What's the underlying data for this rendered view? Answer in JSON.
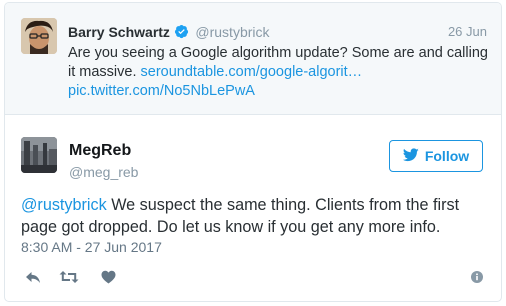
{
  "parent_tweet": {
    "author_name": "Barry Schwartz",
    "verified": true,
    "handle": "@rustybrick",
    "date": "26 Jun",
    "text_line1": "Are you seeing a Google algorithm update? Some are and calling",
    "text_line2_prefix": "it massive. ",
    "link1": "seroundtable.com/google-algorit…",
    "link2": "pic.twitter.com/No5NbLePwA"
  },
  "tweet": {
    "author_name": "MegReb",
    "handle": "@meg_reb",
    "mention": "@rustybrick",
    "text_after_mention": " We suspect the same thing. Clients from the first page got dropped. Do let us know if you get any more info.",
    "timestamp": "8:30 AM - 27 Jun 2017"
  },
  "follow_button": {
    "label": "Follow",
    "icon": "twitter-bird-icon"
  },
  "actions": {
    "reply_icon": "reply-icon",
    "retweet_icon": "retweet-icon",
    "like_icon": "heart-icon",
    "info_icon": "info-icon"
  },
  "colors": {
    "link": "#1b95e0",
    "secondary_text": "#8899a6",
    "action_icon": "#657786"
  }
}
